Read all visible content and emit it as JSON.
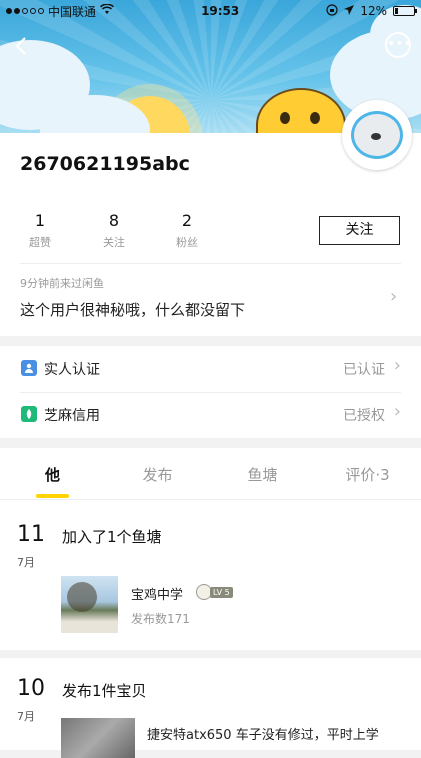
{
  "status_bar": {
    "carrier": "中国联通",
    "time": "19:53",
    "battery": "12%",
    "icons": [
      "signal-dots",
      "wifi-icon",
      "lock-rotation-icon",
      "location-arrow-icon",
      "battery-icon"
    ]
  },
  "nav": {
    "back_icon": "back-chevron-icon",
    "more_icon": "more-dots-icon"
  },
  "profile": {
    "username": "2670621195abc",
    "stats": [
      {
        "value": "1",
        "label": "超赞"
      },
      {
        "value": "8",
        "label": "关注"
      },
      {
        "value": "2",
        "label": "粉丝"
      }
    ],
    "follow_label": "关注",
    "last_visit": "9分钟前来过闲鱼",
    "bio": "这个用户很神秘哦，什么都没留下"
  },
  "verification": [
    {
      "label": "实人认证",
      "status": "已认证",
      "icon": "real-name-icon",
      "color": "#4a90e2"
    },
    {
      "label": "芝麻信用",
      "status": "已授权",
      "icon": "sesame-credit-icon",
      "color": "#1fba7a"
    }
  ],
  "tabs": [
    {
      "label": "他",
      "active": true
    },
    {
      "label": "发布",
      "active": false
    },
    {
      "label": "鱼塘",
      "active": false
    },
    {
      "label": "评价·3",
      "active": false
    }
  ],
  "accent": "#ffd400",
  "feed": [
    {
      "day": "11",
      "month": "7月",
      "title": "加入了1个鱼塘",
      "pond": {
        "name": "宝鸡中学",
        "level": "LV 5",
        "count": "发布数171"
      }
    },
    {
      "day": "10",
      "month": "7月",
      "title": "发布1件宝贝",
      "item_desc": "捷安特atx650 车子没有修过，平时上学"
    }
  ]
}
